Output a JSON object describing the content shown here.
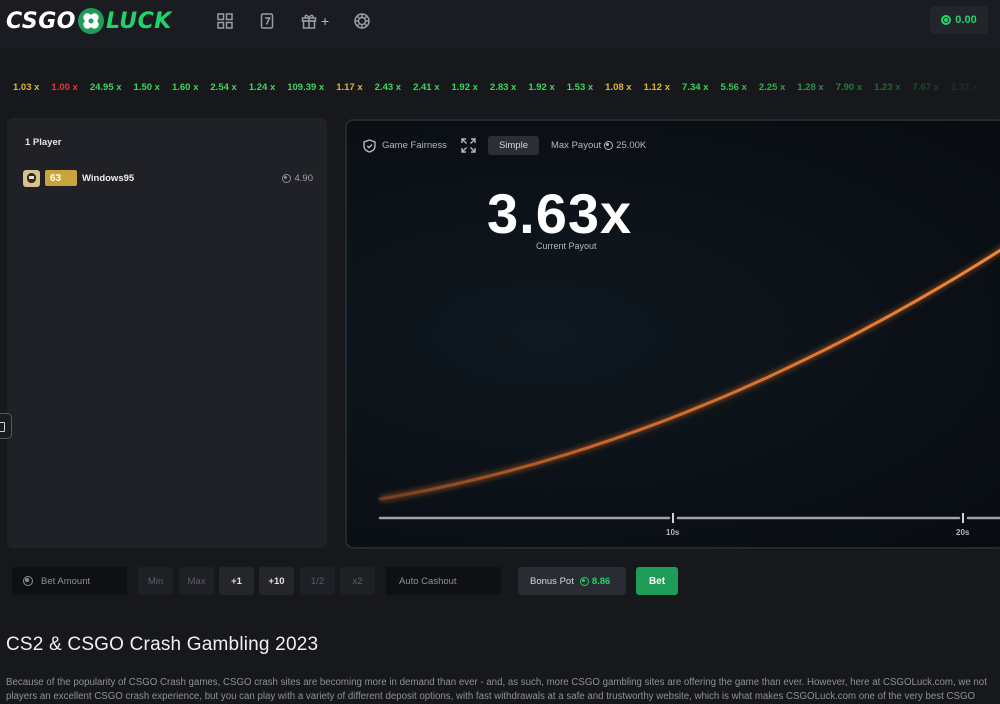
{
  "header": {
    "logo_left": "CSGO",
    "logo_right": "LUCK",
    "nav_icons": [
      "grid-icon",
      "seven-icon",
      "gift-icon",
      "casino-chip-icon"
    ],
    "gift_plus": "+",
    "balance": "0.00",
    "accent": "#22d36b"
  },
  "history": [
    {
      "v": "1.03 x",
      "c": "#e0b43a"
    },
    {
      "v": "1.00 x",
      "c": "#e03838"
    },
    {
      "v": "24.95 x",
      "c": "#3ed45a"
    },
    {
      "v": "1.50 x",
      "c": "#3ed45a"
    },
    {
      "v": "1.60 x",
      "c": "#3ed45a"
    },
    {
      "v": "2.54 x",
      "c": "#3ed45a"
    },
    {
      "v": "1.24 x",
      "c": "#3ed45a"
    },
    {
      "v": "109.39 x",
      "c": "#3ed45a"
    },
    {
      "v": "1.17 x",
      "c": "#e0b43a"
    },
    {
      "v": "2.43 x",
      "c": "#3ed45a"
    },
    {
      "v": "2.41 x",
      "c": "#3ed45a"
    },
    {
      "v": "1.92 x",
      "c": "#3ed45a"
    },
    {
      "v": "2.83 x",
      "c": "#3ed45a"
    },
    {
      "v": "1.92 x",
      "c": "#3ed45a"
    },
    {
      "v": "1.53 x",
      "c": "#3ed45a"
    },
    {
      "v": "1.08 x",
      "c": "#e0b43a"
    },
    {
      "v": "1.12 x",
      "c": "#e0b43a"
    },
    {
      "v": "7.34 x",
      "c": "#3ed45a"
    },
    {
      "v": "5.56 x",
      "c": "#3ed45a"
    },
    {
      "v": "2.25 x",
      "c": "#3ed45a"
    },
    {
      "v": "1.28 x",
      "c": "#3ed45a"
    },
    {
      "v": "7.90 x",
      "c": "#3ed45a"
    },
    {
      "v": "1.23 x",
      "c": "#3ed45a"
    },
    {
      "v": "7.67 x",
      "c": "#3ed45a"
    },
    {
      "v": "1.32 x",
      "c": "#3ed45a"
    }
  ],
  "players": {
    "title": "1 Player",
    "list": [
      {
        "level": "63",
        "name": "Windows95",
        "bet": "4.90"
      }
    ]
  },
  "game": {
    "fairness": "Game Fairness",
    "mode": "Simple",
    "max_payout_label": "Max Payout",
    "max_payout_value": "25.00K",
    "multiplier": "3.63x",
    "multiplier_value": 3.63,
    "payout_label": "Current Payout",
    "ticks": [
      "10s",
      "20s"
    ],
    "curve_color": "#e8742a"
  },
  "controls": {
    "bet_placeholder": "Bet Amount",
    "buttons": [
      {
        "label": "Min",
        "active": false
      },
      {
        "label": "Max",
        "active": false
      },
      {
        "label": "+1",
        "active": true
      },
      {
        "label": "+10",
        "active": true
      },
      {
        "label": "1/2",
        "active": false
      },
      {
        "label": "x2",
        "active": false
      }
    ],
    "auto_cashout_placeholder": "Auto Cashout",
    "bonus_label": "Bonus Pot",
    "bonus_value": "8.86",
    "bet_label": "Bet"
  },
  "article": {
    "title": "CS2 & CSGO Crash Gambling 2023",
    "line1": "Because of the popularity of CSGO Crash games, CSGO crash sites are becoming more in demand than ever - and, as such, more CSGO gambling sites are offering the game than ever. However, here at CSGOLuck.com, we not",
    "line2": "players an excellent CSGO crash experience, but you can play with a variety of different deposit options, with fast withdrawals at a safe and trustworthy website, which is what makes CSGOLuck.com one of the very best CSGO"
  }
}
